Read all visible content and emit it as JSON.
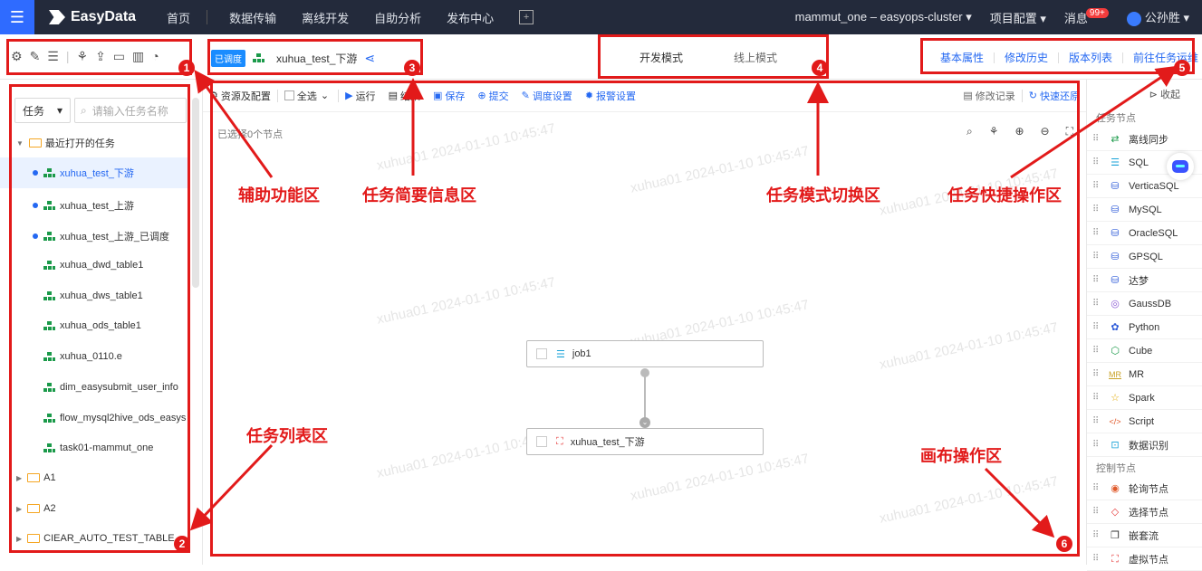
{
  "topnav": {
    "brand": "EasyData",
    "items": [
      "首页",
      "数据传输",
      "离线开发",
      "自助分析",
      "发布中心"
    ],
    "cluster": "mammut_one – easyops-cluster ▾",
    "project_config": "项目配置 ▾",
    "messages": "消息",
    "messages_badge": "99+",
    "user": "公孙胜 ▾"
  },
  "task_info": {
    "status": "已调度",
    "name": "xuhua_test_下游"
  },
  "modes": [
    "开发模式",
    "线上模式"
  ],
  "quick_ops": [
    "基本属性",
    "修改历史",
    "版本列表",
    "前往任务运维"
  ],
  "left": {
    "select_value": "任务",
    "search_placeholder": "请输入任务名称",
    "recent_folder": "最近打开的任务",
    "tasks": [
      "xuhua_test_下游",
      "xuhua_test_上游",
      "xuhua_test_上游_已调度",
      "xuhua_dwd_table1",
      "xuhua_dws_table1",
      "xuhua_ods_table1",
      "xuhua_0110.e",
      "dim_easysubmit_user_info",
      "flow_mysql2hive_ods_easys",
      "task01-mammut_one"
    ],
    "folders": [
      "A1",
      "A2",
      "CIEAR_AUTO_TEST_TABLE"
    ]
  },
  "canvas_toolbar": {
    "resource": "资源及配置",
    "select_all": "全选",
    "run": "运行",
    "result": "结果",
    "save": "保存",
    "submit": "提交",
    "schedule": "调度设置",
    "alarm": "报警设置",
    "modify_log": "修改记录",
    "quick_restore": "快速还原"
  },
  "canvas": {
    "selected_count": "已选择0个节点",
    "nodes": [
      "job1",
      "xuhua_test_下游"
    ],
    "watermark": "xuhua01 2024-01-10 10:45:47"
  },
  "right": {
    "collapse": "收起",
    "task_section": "任务节点",
    "task_nodes": [
      "离线同步",
      "SQL",
      "VerticaSQL",
      "MySQL",
      "OracleSQL",
      "GPSQL",
      "达梦",
      "GaussDB",
      "Python",
      "Cube",
      "MR",
      "Spark",
      "Script",
      "数据识别"
    ],
    "control_section": "控制节点",
    "control_nodes": [
      "轮询节点",
      "选择节点",
      "嵌套流",
      "虚拟节点"
    ]
  },
  "annotations": {
    "n1": "1",
    "n2": "2",
    "n3": "3",
    "n4": "4",
    "n5": "5",
    "n6": "6",
    "aux": "辅助功能区",
    "info": "任务简要信息区",
    "mode": "任务模式切换区",
    "quick": "任务快捷操作区",
    "list": "任务列表区",
    "canvas_ops": "画布操作区"
  },
  "colors": {
    "annotation": "#e21a1a",
    "accent": "#2468f2",
    "topnav_bg": "#232a3b"
  }
}
